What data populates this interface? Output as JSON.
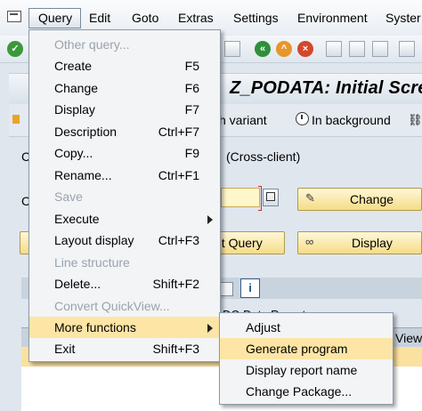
{
  "menubar": {
    "items": [
      {
        "label": "Query",
        "active": true
      },
      {
        "label": "Edit"
      },
      {
        "label": "Goto"
      },
      {
        "label": "Extras"
      },
      {
        "label": "Settings"
      },
      {
        "label": "Environment"
      },
      {
        "label": "Syster"
      }
    ]
  },
  "toolbar": {
    "icons": [
      "back-icon",
      "exit-icon",
      "cancel-icon",
      "print-icon",
      "find-icon"
    ]
  },
  "window_title": "Z_PODATA: Initial Scre",
  "app_toolbar": {
    "variant_label": "h variant",
    "background_label": "In background"
  },
  "content": {
    "cross_client": "(Cross-client)",
    "change_button": "Change",
    "set_query_button": "et Query",
    "display_button": "Display",
    "report_partial": "DO Data Report",
    "view_col": "View",
    "left_c1": "C",
    "left_c2": "C"
  },
  "query_menu": {
    "items": [
      {
        "label": "Other query...",
        "shortcut": "",
        "disabled": true
      },
      {
        "label": "Create",
        "shortcut": "F5"
      },
      {
        "label": "Change",
        "shortcut": "F6"
      },
      {
        "label": "Display",
        "shortcut": "F7"
      },
      {
        "label": "Description",
        "shortcut": "Ctrl+F7"
      },
      {
        "label": "Copy...",
        "shortcut": "F9"
      },
      {
        "label": "Rename...",
        "shortcut": "Ctrl+F1"
      },
      {
        "label": "Save",
        "shortcut": "",
        "disabled": true
      },
      {
        "label": "Execute",
        "shortcut": "",
        "submenu": true
      },
      {
        "label": "Layout display",
        "shortcut": "Ctrl+F3"
      },
      {
        "label": "Line structure",
        "shortcut": "",
        "disabled": true
      },
      {
        "label": "Delete...",
        "shortcut": "Shift+F2"
      },
      {
        "label": "Convert QuickView...",
        "shortcut": "",
        "disabled": true
      },
      {
        "label": "More functions",
        "shortcut": "",
        "submenu": true,
        "highlighted": true
      },
      {
        "label": "Exit",
        "shortcut": "Shift+F3"
      }
    ]
  },
  "more_functions_menu": {
    "items": [
      {
        "label": "Adjust"
      },
      {
        "label": "Generate program",
        "highlighted": true
      },
      {
        "label": "Display report name"
      },
      {
        "label": "Change Package..."
      }
    ]
  },
  "colors": {
    "highlight": "#fde5a5",
    "input_required": "#fff7c9",
    "button_yellow": "#f5dc86",
    "background": "#dfe6ee"
  }
}
